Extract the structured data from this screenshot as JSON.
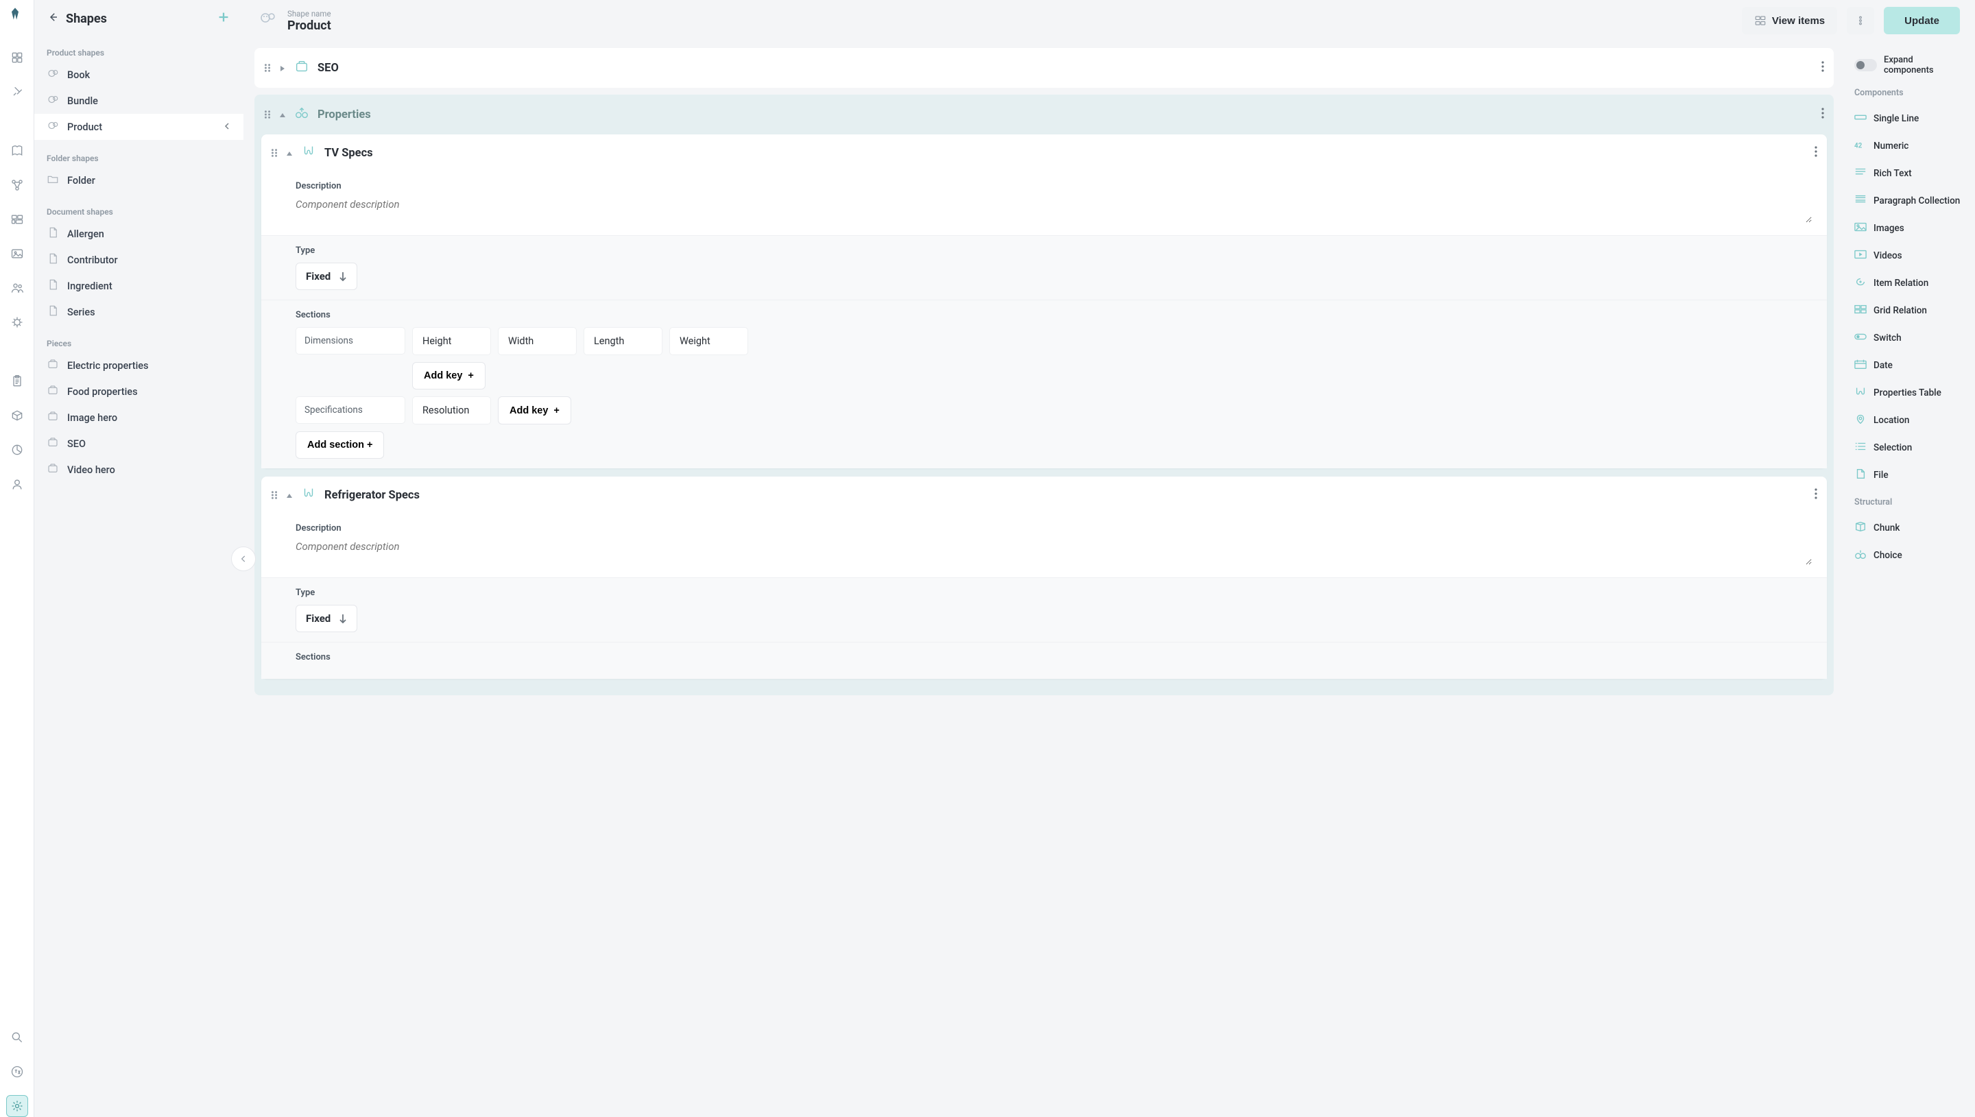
{
  "sidebar": {
    "title": "Shapes",
    "groups": [
      {
        "label": "Product shapes",
        "items": [
          {
            "label": "Book",
            "icon": "product"
          },
          {
            "label": "Bundle",
            "icon": "product"
          },
          {
            "label": "Product",
            "icon": "product",
            "active": true
          }
        ]
      },
      {
        "label": "Folder shapes",
        "items": [
          {
            "label": "Folder",
            "icon": "folder"
          }
        ]
      },
      {
        "label": "Document shapes",
        "items": [
          {
            "label": "Allergen",
            "icon": "doc"
          },
          {
            "label": "Contributor",
            "icon": "doc"
          },
          {
            "label": "Ingredient",
            "icon": "doc"
          },
          {
            "label": "Series",
            "icon": "doc"
          }
        ]
      },
      {
        "label": "Pieces",
        "items": [
          {
            "label": "Electric properties",
            "icon": "piece"
          },
          {
            "label": "Food properties",
            "icon": "piece"
          },
          {
            "label": "Image hero",
            "icon": "piece"
          },
          {
            "label": "SEO",
            "icon": "piece"
          },
          {
            "label": "Video hero",
            "icon": "piece"
          }
        ]
      }
    ]
  },
  "header": {
    "shape_name_label": "Shape name",
    "shape_name": "Product",
    "view_items_label": "View items",
    "update_label": "Update"
  },
  "editor": {
    "components": [
      {
        "title": "SEO",
        "expanded": false,
        "type_icon": "piece"
      },
      {
        "title": "Properties",
        "expanded": true,
        "type_icon": "choice",
        "children": [
          {
            "title": "TV Specs",
            "expanded": true,
            "type_icon": "table",
            "description_label": "Description",
            "description_placeholder": "Component description",
            "type_label": "Type",
            "type_value": "Fixed",
            "sections_label": "Sections",
            "sections": [
              {
                "name": "Dimensions",
                "keys": [
                  "Height",
                  "Width",
                  "Length",
                  "Weight"
                ]
              },
              {
                "name": "Specifications",
                "keys": [
                  "Resolution"
                ]
              }
            ],
            "add_key_label": "Add key",
            "add_section_label": "Add section +"
          },
          {
            "title": "Refrigerator Specs",
            "expanded": true,
            "type_icon": "table",
            "description_label": "Description",
            "description_placeholder": "Component description",
            "type_label": "Type",
            "type_value": "Fixed",
            "sections_label": "Sections"
          }
        ]
      }
    ]
  },
  "right": {
    "expand_label": "Expand components",
    "components_label": "Components",
    "components": [
      "Single Line",
      "Numeric",
      "Rich Text",
      "Paragraph Collection",
      "Images",
      "Videos",
      "Item Relation",
      "Grid Relation",
      "Switch",
      "Date",
      "Properties Table",
      "Location",
      "Selection",
      "File"
    ],
    "structural_label": "Structural",
    "structural": [
      "Chunk",
      "Choice"
    ]
  }
}
